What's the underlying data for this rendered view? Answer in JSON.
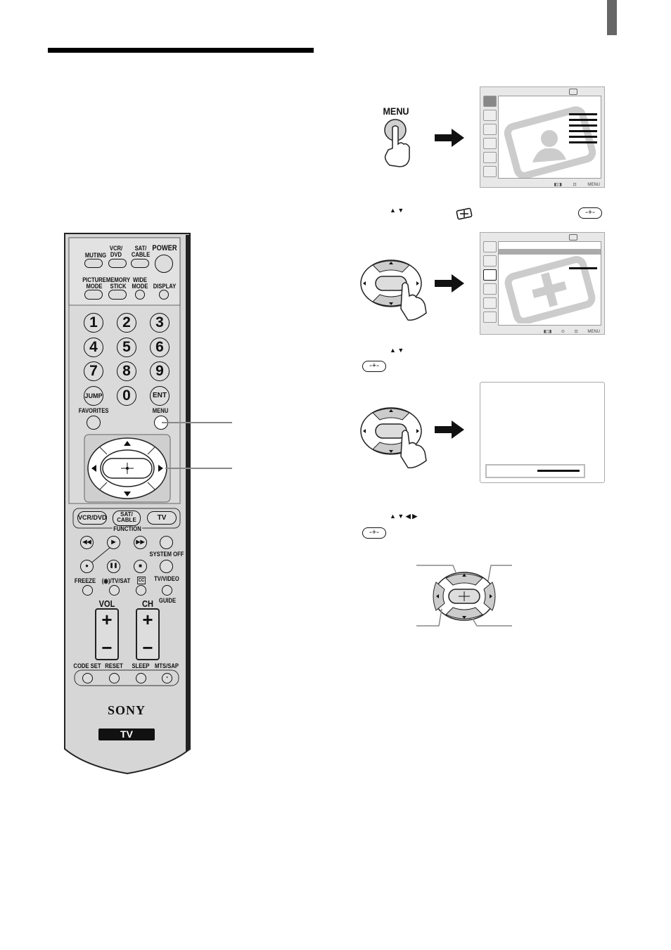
{
  "page": {
    "tab_marker": "section-tab",
    "header_rule": true
  },
  "remote": {
    "brand": "SONY",
    "model_badge": "TV",
    "top_buttons": [
      {
        "label": "MUTING"
      },
      {
        "label": "VCR/\nDVD"
      },
      {
        "label": "SAT/\nCABLE"
      },
      {
        "label": "POWER"
      }
    ],
    "second_row": [
      {
        "label": "PICTURE\nMODE"
      },
      {
        "label": "MEMORY\nSTICK"
      },
      {
        "label": "WIDE\nMODE"
      },
      {
        "label": "DISPLAY"
      }
    ],
    "numpad": [
      "1",
      "2",
      "3",
      "4",
      "5",
      "6",
      "7",
      "8",
      "9",
      "JUMP",
      "0",
      "ENT"
    ],
    "favorites_label": "FAVORITES",
    "menu_label": "MENU",
    "function_buttons": [
      "VCR/DVD",
      "SAT/\nCABLE",
      "TV"
    ],
    "function_label": "FUNCTION",
    "transport": [
      "◀◀",
      "▶",
      "▶▶",
      "",
      "●",
      "❚❚",
      "■",
      ""
    ],
    "system_off_label": "SYSTEM OFF",
    "freeze_label": "FREEZE",
    "tvsat_label": "(◉)/TV/SAT",
    "cc_label": "CC",
    "tvvideo_label": "TV/VIDEO",
    "guide_label": "GUIDE",
    "vol_label": "VOL",
    "ch_label": "CH",
    "plus": "+",
    "minus": "−",
    "bottom_labels": [
      "CODE SET",
      "RESET",
      "SLEEP",
      "MTS/SAP"
    ]
  },
  "steps": {
    "step1": {
      "button_label": "MENU"
    },
    "step2": {
      "arrows": "▲ ▼",
      "icon": "setup-icon",
      "enter": "-+-"
    },
    "step3": {
      "arrows": "▲ ▼",
      "enter": "-+-"
    },
    "step4": {
      "arrows": "▲ ▼ ◀ ▶",
      "enter": "-+-"
    }
  },
  "screen": {
    "footer_icons": [
      "◧◨",
      "⊡",
      "MENU"
    ],
    "footer_icons_2": [
      "◧◨",
      "⊙",
      "⊡",
      "MENU"
    ]
  }
}
